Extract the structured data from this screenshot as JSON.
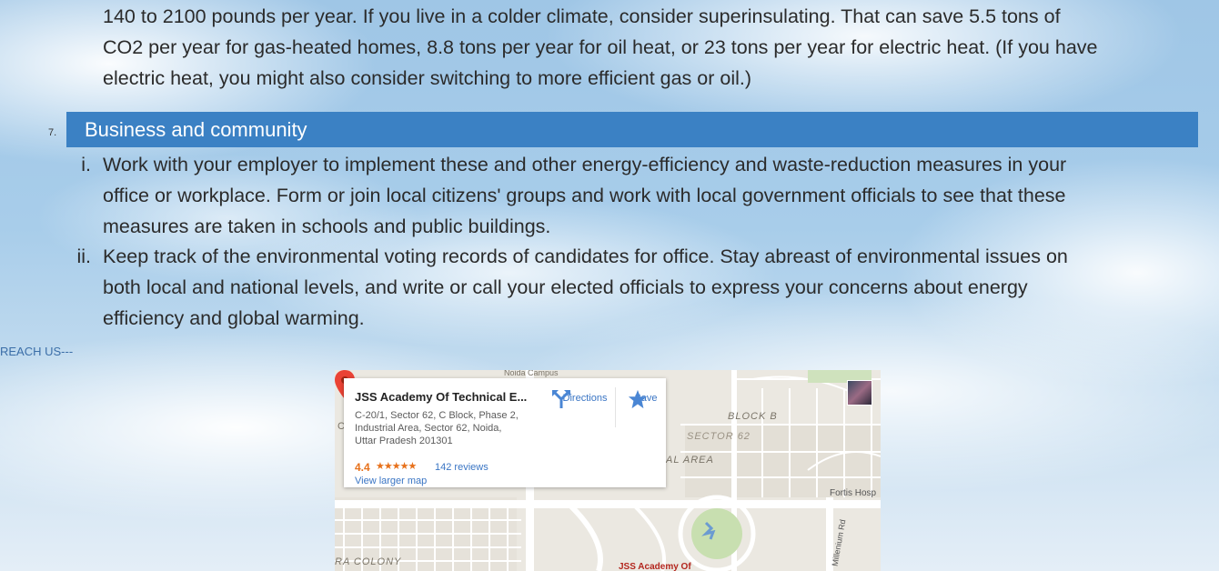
{
  "intro_paragraph": {
    "line1": "140 to 2100 pounds per year. If you live in a colder climate, consider superinsulating. That can save 5.5 tons of",
    "line2": "CO2 per year for gas-heated homes, 8.8 tons per year for oil heat, or 23 tons per year for electric heat. (If you have",
    "line3": "electric heat, you might also consider switching to more efficient gas or oil.)"
  },
  "section": {
    "number": "7.",
    "title": "Business and community",
    "bar_color": "#3b81c4",
    "items": [
      {
        "marker": "i.",
        "lines": [
          "Work with your employer to implement these and other energy-efficiency and waste-reduction measures in your",
          "office or workplace. Form or join local citizens' groups and work with local government officials to see that these",
          "measures are taken in schools and public buildings."
        ]
      },
      {
        "marker": "ii.",
        "lines": [
          "Keep track of the environmental voting records of candidates for office. Stay abreast of environmental issues on",
          "both local and national levels, and write or call your elected officials to express your concerns about energy",
          "efficiency and global warming."
        ]
      }
    ]
  },
  "reach_us": "REACH US---",
  "map": {
    "card": {
      "title": "JSS Academy Of Technical E...",
      "address_lines": [
        "C-20/1, Sector 62, C Block, Phase 2,",
        "Industrial Area, Sector 62, Noida,",
        "Uttar Pradesh 201301"
      ],
      "rating": "4.4",
      "stars": "★★★★★",
      "reviews": "142 reviews",
      "larger_map": "View larger map",
      "directions": "Directions",
      "save": "Save"
    },
    "labels": {
      "campus": "Noida Campus",
      "block_b": "BLOCK B",
      "sector": "SECTOR 62",
      "area": "AL AREA",
      "fortis": "Fortis Hosp",
      "millenium": "Millenium Rd",
      "colony": "RA COLONY",
      "pin_label": "JSS Academy Of",
      "c": "C"
    },
    "icons": [
      "directions-icon",
      "star-icon",
      "map-pin-icon",
      "avatar"
    ]
  }
}
